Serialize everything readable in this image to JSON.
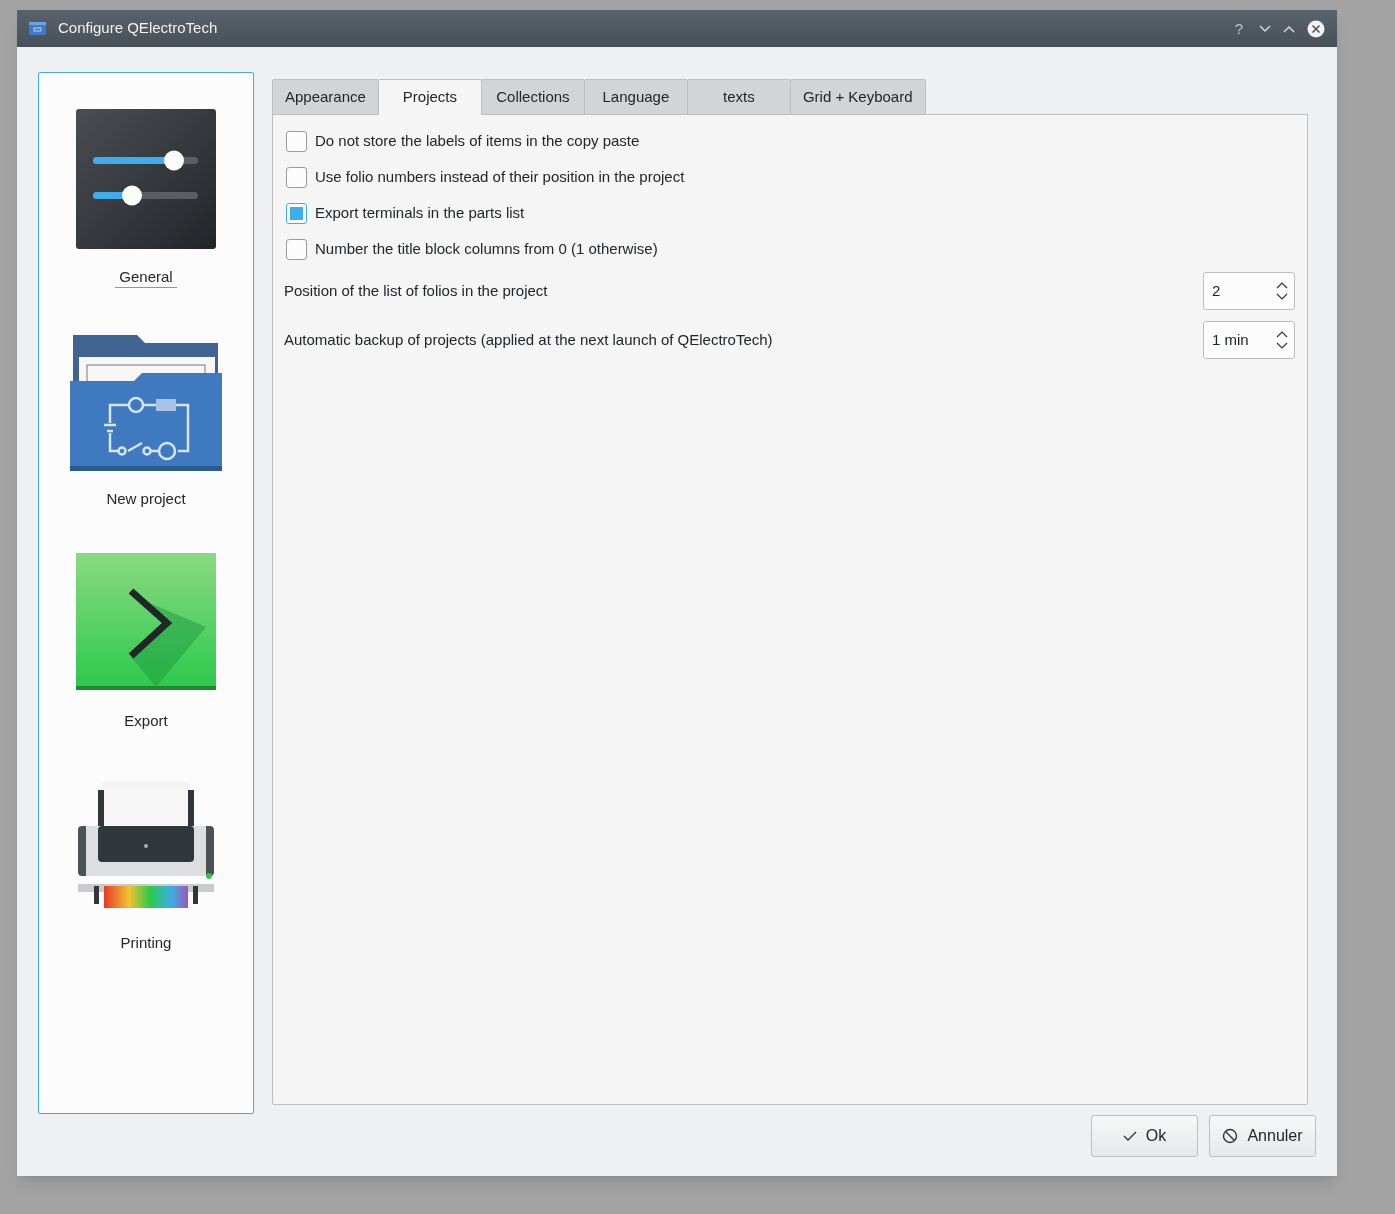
{
  "window": {
    "title": "Configure QElectroTech"
  },
  "title_buttons": [
    {
      "kind": "help",
      "label": "?"
    },
    {
      "kind": "minimize"
    },
    {
      "kind": "maximize"
    },
    {
      "kind": "close"
    }
  ],
  "sidebar": {
    "items": [
      {
        "label": "General",
        "kind": "sliders",
        "selected": true
      },
      {
        "label": "New project",
        "kind": "folder",
        "selected": false
      },
      {
        "label": "Export",
        "kind": "export",
        "selected": false
      },
      {
        "label": "Printing",
        "kind": "printer",
        "selected": false
      }
    ]
  },
  "tabs": [
    {
      "label": "Appearance",
      "selected": false
    },
    {
      "label": "Projects",
      "selected": true
    },
    {
      "label": "Collections",
      "selected": false
    },
    {
      "label": "Language",
      "selected": false
    },
    {
      "label": "texts",
      "selected": false
    },
    {
      "label": "Grid + Keyboard",
      "selected": false
    }
  ],
  "options": [
    {
      "label": "Do not store the labels of items in the copy paste",
      "checked": false
    },
    {
      "label": "Use folio numbers instead of their position in the project",
      "checked": false
    },
    {
      "label": "Export terminals in the parts list",
      "checked": true
    },
    {
      "label": "Number the title block columns from 0 (1 otherwise)",
      "checked": false
    }
  ],
  "spin_fields": [
    {
      "label": "Position of the list of folios in the project",
      "value": "2"
    },
    {
      "label": "Automatic backup of projects (applied at the next launch of QElectroTech)",
      "value": "1 min"
    }
  ],
  "buttons": [
    {
      "kind": "ok",
      "label": "Ok"
    },
    {
      "kind": "cancel",
      "label": "Annuler"
    }
  ]
}
